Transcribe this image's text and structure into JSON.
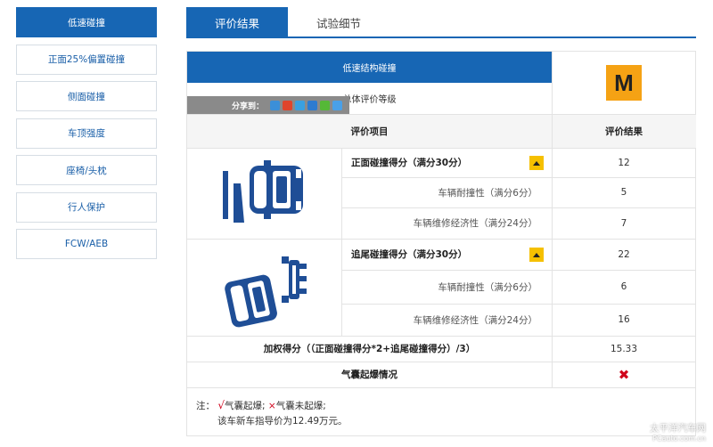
{
  "sidebar": {
    "items": [
      {
        "label": "低速碰撞"
      },
      {
        "label": "正面25%偏置碰撞"
      },
      {
        "label": "侧面碰撞"
      },
      {
        "label": "车顶强度"
      },
      {
        "label": "座椅/头枕"
      },
      {
        "label": "行人保护"
      },
      {
        "label": "FCW/AEB"
      }
    ]
  },
  "tabs": [
    {
      "label": "评价结果"
    },
    {
      "label": "试验细节"
    }
  ],
  "panel": {
    "section_title": "低速结构碰撞",
    "overall_label": "总体评价等级",
    "overall_rating": "M",
    "share_label": "分享到：",
    "table_headers": {
      "item": "评价项目",
      "result": "评价结果"
    },
    "front": {
      "title": "正面碰撞得分（满分30分）",
      "score": "12",
      "sub1_label": "车辆耐撞性（满分6分）",
      "sub1_value": "5",
      "sub2_label": "车辆维修经济性（满分24分）",
      "sub2_value": "7"
    },
    "rear": {
      "title": "追尾碰撞得分（满分30分）",
      "score": "22",
      "sub1_label": "车辆耐撞性（满分6分）",
      "sub1_value": "6",
      "sub2_label": "车辆维修经济性（满分24分）",
      "sub2_value": "16"
    },
    "weighted_label": "加权得分（（正面碰撞得分*2+追尾碰撞得分）/3）",
    "weighted_value": "15.33",
    "airbag_label": "气囊起爆情况",
    "notes": {
      "prefix": "注：",
      "deployed": "气囊起爆;",
      "not_deployed": "气囊未起爆;",
      "price_line": "该车新车指导价为12.49万元。"
    }
  },
  "watermark": {
    "line1": "太平洋汽车网",
    "line2": "PCauto.com.cn"
  },
  "colors": {
    "brand_blue": "#1766b4",
    "rating_orange": "#f5a214",
    "indicator_yellow": "#f5c000",
    "red": "#d0021b"
  }
}
